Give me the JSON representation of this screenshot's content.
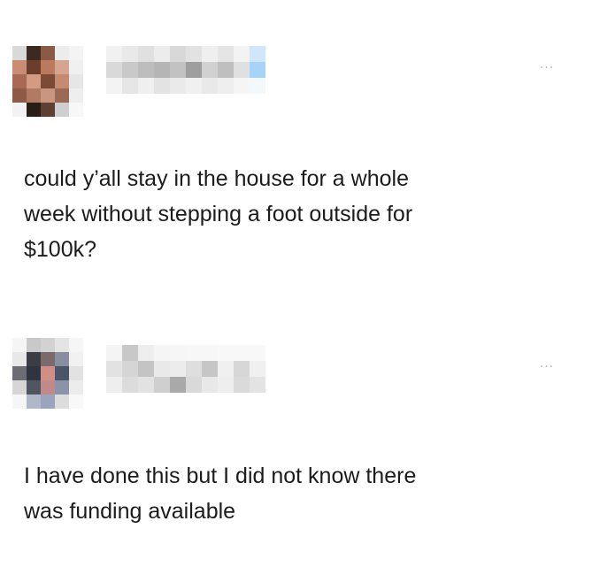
{
  "posts": [
    {
      "author": {
        "avatar_pixels": [
          [
            "#d9d9d9",
            "#3a2a22",
            "#8a5a44",
            "#ececec",
            "#f4f4f4"
          ],
          [
            "#c98d73",
            "#6b3d2b",
            "#b97a60",
            "#d7a58f",
            "#f0f0f0"
          ],
          [
            "#a86a52",
            "#d49b82",
            "#7d4a36",
            "#c48a72",
            "#e6e6e6"
          ],
          [
            "#8e5a46",
            "#b07a63",
            "#c99680",
            "#9a6a56",
            "#eeeeee"
          ],
          [
            "#f2f2f2",
            "#2a1c16",
            "#5e4032",
            "#cfcfcf",
            "#f7f7f7"
          ]
        ],
        "name_pixels": [
          [
            "#f1f1f1",
            "#d9d9d9",
            "#f3f3f3"
          ],
          [
            "#e9e9e9",
            "#c9c9c9",
            "#e6e6e6"
          ],
          [
            "#e0e0e0",
            "#bdbdbd",
            "#efefef"
          ],
          [
            "#ececec",
            "#b5b5b5",
            "#e3e3e3"
          ],
          [
            "#d8d8d8",
            "#c2c2c2",
            "#eaeaea"
          ],
          [
            "#e2e2e2",
            "#9e9e9e",
            "#f0f0f0"
          ],
          [
            "#efefef",
            "#d1d1d1",
            "#e9e9e9"
          ],
          [
            "#e5e5e5",
            "#bfbfbf",
            "#eeeeee"
          ],
          [
            "#f3f3f3",
            "#e0e0e0",
            "#f5f5f5"
          ],
          [
            "#cfe6fb",
            "#a7d3f8",
            "#f3f8fd"
          ]
        ]
      },
      "more_label": "...",
      "text": "could y’all stay in the house for a whole\nweek without stepping a foot outside for\n$100k?"
    },
    {
      "author": {
        "avatar_pixels": [
          [
            "#f5f5f5",
            "#c9c9c9",
            "#d2d2d2",
            "#e4e4e4",
            "#f6f6f6"
          ],
          [
            "#e8e8e8",
            "#3c3c46",
            "#7a6a6a",
            "#8a8fa0",
            "#f1f1f1"
          ],
          [
            "#6c6c74",
            "#2f3440",
            "#d08f86",
            "#4a5568",
            "#e2e2e2"
          ],
          [
            "#d6d6d6",
            "#50555f",
            "#c18a8a",
            "#8b93a8",
            "#ececec"
          ],
          [
            "#f6f6f6",
            "#b0b7c8",
            "#9aa4bd",
            "#dcdcdc",
            "#f8f8f8"
          ]
        ],
        "name_pixels": [
          [
            "#f4f4f4",
            "#e2e2e2",
            "#eeeeee"
          ],
          [
            "#c8c8c8",
            "#d5d5d5",
            "#dcdcdc"
          ],
          [
            "#eeeeee",
            "#c4c4c4",
            "#e2e2e2"
          ],
          [
            "#f5f5f5",
            "#e9e9e9",
            "#cfcfcf"
          ],
          [
            "#f6f6f6",
            "#ececec",
            "#a9a9a9"
          ],
          [
            "#f7f7f7",
            "#dedede",
            "#d9d9d9"
          ],
          [
            "#f7f7f7",
            "#c6c6c6",
            "#e8e8e8"
          ],
          [
            "#f8f8f8",
            "#f0f0f0",
            "#eeeeee"
          ],
          [
            "#f8f8f8",
            "#d7d7d7",
            "#dadada"
          ],
          [
            "#f8f8f8",
            "#f0f0f0",
            "#e3e3e3"
          ]
        ]
      },
      "more_label": "...",
      "text": "I have done this but I did not know there\nwas funding available"
    }
  ]
}
